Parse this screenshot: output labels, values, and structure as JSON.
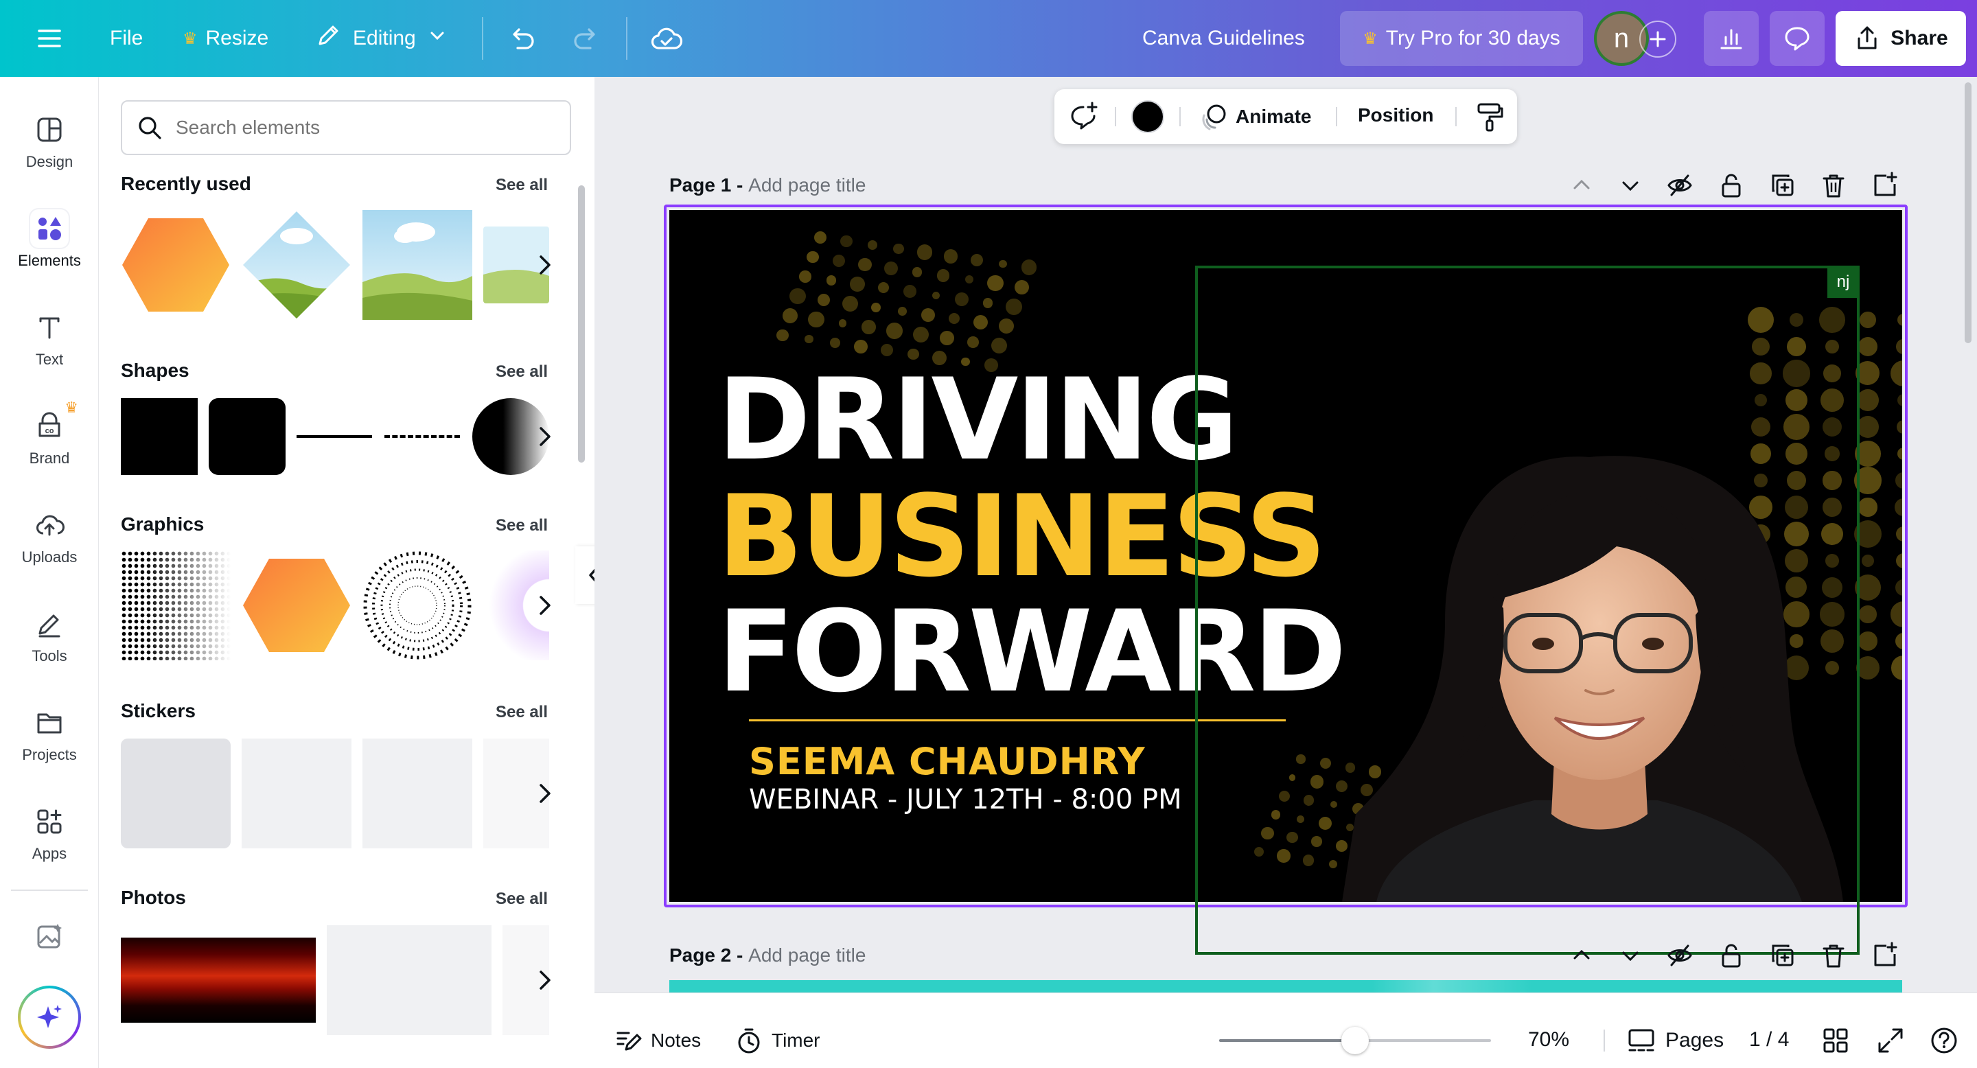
{
  "topbar": {
    "file_label": "File",
    "resize_label": "Resize",
    "editing_label": "Editing",
    "doc_title": "Canva Guidelines",
    "try_pro_label": "Try Pro for 30 days",
    "avatar_letter": "n",
    "share_label": "Share"
  },
  "rail": {
    "items": [
      {
        "label": "Design"
      },
      {
        "label": "Elements"
      },
      {
        "label": "Text"
      },
      {
        "label": "Brand"
      },
      {
        "label": "Uploads"
      },
      {
        "label": "Tools"
      },
      {
        "label": "Projects"
      },
      {
        "label": "Apps"
      }
    ]
  },
  "panel": {
    "search_placeholder": "Search elements",
    "sections": [
      {
        "title": "Recently used",
        "see_all": "See all"
      },
      {
        "title": "Shapes",
        "see_all": "See all"
      },
      {
        "title": "Graphics",
        "see_all": "See all"
      },
      {
        "title": "Stickers",
        "see_all": "See all"
      },
      {
        "title": "Photos",
        "see_all": "See all"
      }
    ]
  },
  "context_toolbar": {
    "animate_label": "Animate",
    "position_label": "Position"
  },
  "pages": [
    {
      "label": "Page 1 -",
      "title_placeholder": "Add page title"
    },
    {
      "label": "Page 2 -",
      "title_placeholder": "Add page title"
    }
  ],
  "design": {
    "line1": "DRIVING",
    "line2": "BUSINESS",
    "line3": "FORWARD",
    "name": "SEEMA CHAUDHRY",
    "subtitle": "WEBINAR - JULY 12TH - 8:00 PM",
    "collaborator_tag": "nj",
    "accent_color": "#f9c22e",
    "background_color": "#000000"
  },
  "bottombar": {
    "notes_label": "Notes",
    "timer_label": "Timer",
    "zoom_label": "70%",
    "zoom_fraction": 0.5,
    "pages_label": "Pages",
    "page_count": "1 / 4"
  },
  "colors": {
    "selection": "#8b3dff",
    "collab_frame": "#0f5e1e"
  }
}
